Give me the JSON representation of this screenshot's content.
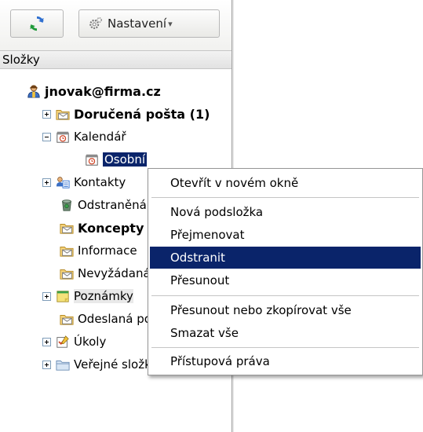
{
  "colors": {
    "selection": "#0a246a",
    "pane_border": "#a0a0a0",
    "menu_border": "#979797"
  },
  "toolbar": {
    "refresh_icon": "refresh-icon",
    "settings_icon": "gear-icon",
    "settings_label": "Nastavení",
    "settings_arrow": "▾"
  },
  "section": {
    "title": "Složky"
  },
  "tree": {
    "account": "jnovak@firma.cz",
    "inbox": "Doručená pošta (1)",
    "calendar": "Kalendář",
    "calendar_personal": "Osobní",
    "contacts": "Kontakty",
    "deleted": "Odstraněná pošta",
    "drafts": "Koncepty",
    "info": "Informace",
    "junk": "Nevyžádaná pošta",
    "notes": "Poznámky",
    "sent": "Odeslaná pošta",
    "tasks": "Úkoly",
    "public": "Veřejné složky"
  },
  "context_menu": {
    "items": [
      "Otevřít v novém okně",
      "Nová podsložka",
      "Přejmenovat",
      "Odstranit",
      "Přesunout",
      "Přesunout nebo zkopírovat vše",
      "Smazat vše",
      "Přístupová práva"
    ],
    "active_item": "Odstranit"
  }
}
